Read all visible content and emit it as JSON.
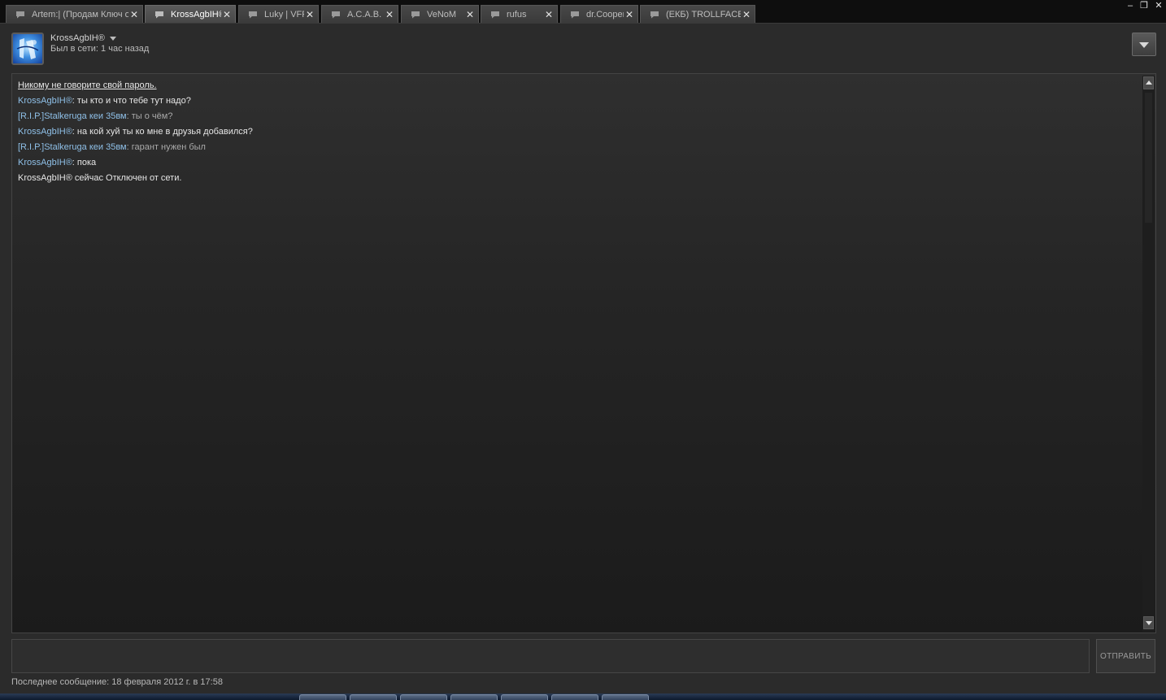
{
  "tabs": [
    {
      "label": "Artem:| (Продам Ключ о...",
      "active": false
    },
    {
      "label": "KrossAgbIH®",
      "active": true
    },
    {
      "label": "Luky | VFR",
      "active": false
    },
    {
      "label": "A.C.A.B.",
      "active": false
    },
    {
      "label": "VeNoM",
      "active": false
    },
    {
      "label": "rufus",
      "active": false
    },
    {
      "label": "dr.Cooper",
      "active": false
    },
    {
      "label": "(ЕКБ) TROLLFACE",
      "active": false
    }
  ],
  "window_controls": {
    "minimize": "–",
    "restore": "❐",
    "close": "✕"
  },
  "friend": {
    "name": "KrossAgbIH®",
    "status": "Был в сети: 1 час назад"
  },
  "chat": {
    "warning": "Никому не говорите свой пароль.",
    "messages": [
      {
        "sender": "KrossAgbIH®",
        "text": "ты кто и что тебе тут надо?",
        "role": "self"
      },
      {
        "sender": "[R.I.P.]Stalkeruga кеи 35вм",
        "text": "ты о чём?",
        "role": "other"
      },
      {
        "sender": "KrossAgbIH®",
        "text": "на кой хуй ты ко мне в друзья добавился?",
        "role": "self"
      },
      {
        "sender": "[R.I.P.]Stalkeruga кеи 35вм",
        "text": "гарант нужен был",
        "role": "other"
      },
      {
        "sender": "KrossAgbIH®",
        "text": "пока",
        "role": "self"
      }
    ],
    "system_message": "KrossAgbIH® сейчас Отключен от сети."
  },
  "composer": {
    "value": "",
    "send_label": "ОТПРАВИТЬ"
  },
  "footer": {
    "last_message": "Последнее сообщение: 18 февраля 2012 г. в 17:58"
  },
  "colors": {
    "accent_name": "#8fc0e8",
    "background": "#2b2b2b",
    "tabbar": "#0e0e0e"
  }
}
